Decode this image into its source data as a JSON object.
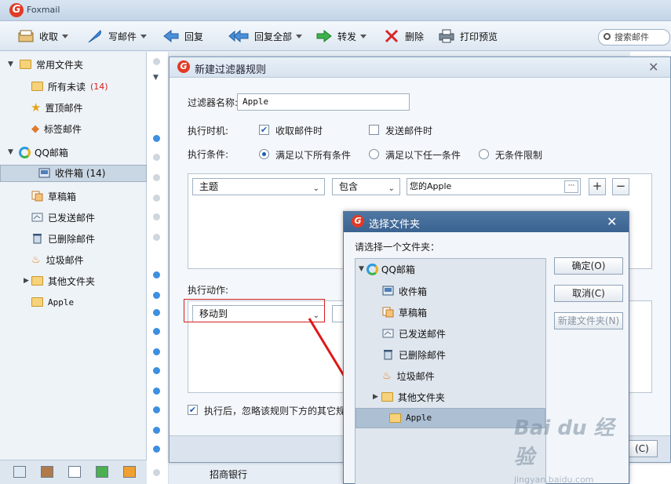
{
  "app": {
    "title": "Foxmail"
  },
  "toolbar": {
    "receive": "收取",
    "compose": "写邮件",
    "reply": "回复",
    "reply_all": "回复全部",
    "forward": "转发",
    "delete": "删除",
    "print_preview": "打印预览",
    "search_placeholder": "搜索邮件"
  },
  "sidebar": {
    "common_folders": "常用文件夹",
    "all_unread": "所有未读",
    "unread_count": "(14)",
    "pinned": "置顶邮件",
    "tagged": "标签邮件",
    "qq_mailbox": "QQ邮箱",
    "inbox": "收件箱 (14)",
    "drafts": "草稿箱",
    "sent": "已发送邮件",
    "deleted": "已删除邮件",
    "junk": "垃圾邮件",
    "other": "其他文件夹",
    "apple": "Apple"
  },
  "list": {
    "bottom_item": "招商银行"
  },
  "filter_dialog": {
    "title": "新建过滤器规则",
    "name_label": "过滤器名称:",
    "name_value": "Apple",
    "timing_label": "执行时机:",
    "on_receive": "收取邮件时",
    "on_send": "发送邮件时",
    "condition_label": "执行条件:",
    "cond_all": "满足以下所有条件",
    "cond_any": "满足以下任一条件",
    "cond_none": "无条件限制",
    "field_select": "主题",
    "op_select": "包含",
    "value": "您的Apple",
    "ellipsis": "···",
    "add": "+",
    "remove": "−",
    "action_label": "执行动作:",
    "action_select": "移动到",
    "stop_text": "执行后，忽略该规则下方的其它规",
    "partial_button": "(C)"
  },
  "folder_dialog": {
    "title": "选择文件夹",
    "prompt": "请选择一个文件夹：",
    "tree": {
      "root": "QQ邮箱",
      "inbox": "收件箱",
      "drafts": "草稿箱",
      "sent": "已发送邮件",
      "deleted": "已删除邮件",
      "junk": "垃圾邮件",
      "other": "其他文件夹",
      "apple": "Apple"
    },
    "ok": "确定(O)",
    "cancel": "取消(C)",
    "new_folder": "新建文件夹(N)"
  },
  "watermark": {
    "brand": "Bai du 经验",
    "url": "jingyan.baidu.com"
  }
}
